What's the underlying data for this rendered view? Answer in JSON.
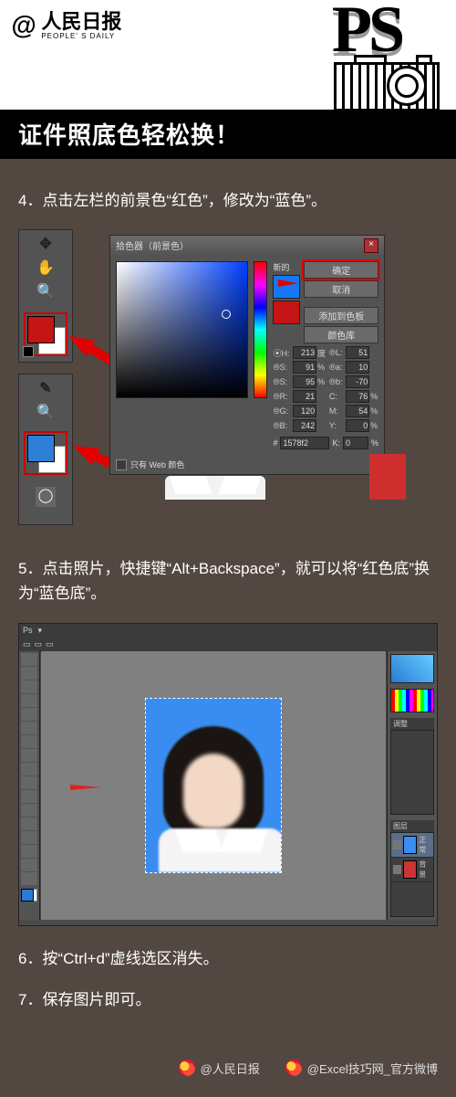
{
  "brand": {
    "at": "@",
    "cn": "人民日报",
    "en": "PEOPLE' S DAILY"
  },
  "header": {
    "ps": "PS",
    "title": "证件照底色轻松换！"
  },
  "steps": {
    "s4": "4．点击左栏的前景色“红色”，修改为“蓝色”。",
    "s5": "5．点击照片，快捷键“Alt+Backspace”，就可以将“红色底”换为“蓝色底”。",
    "s6": "6．按“Ctrl+d”虚线选区消失。",
    "s7": "7．保存图片即可。"
  },
  "picker": {
    "title": "拾色器（前景色）",
    "newLabel": "新的",
    "ok": "确定",
    "cancel": "取消",
    "addSwatch": "添加到色板",
    "colorLib": "颜色库",
    "fields": {
      "H": "213",
      "Hdeg": "度",
      "L": "51",
      "S1": "91",
      "pct1": "%",
      "a": "10",
      "S2": "95",
      "pct2": "%",
      "b": "-70",
      "R": "21",
      "C": "76",
      "G": "120",
      "M": "54",
      "B": "242",
      "Y": "0",
      "hex": "1578f2",
      "K": "0"
    },
    "webOnly": "只有 Web 颜色"
  },
  "psWindow": {
    "tabsLabel": "调整",
    "layersLabel": "图层",
    "layerNormal": "正常",
    "layerBg": "背景"
  },
  "footer": {
    "a": "@人民日报",
    "b": "@Excel技巧网_官方微博"
  },
  "icons": {
    "lasso": "✥",
    "hand": "✋",
    "zoom": "🔍",
    "mask": "◯"
  }
}
